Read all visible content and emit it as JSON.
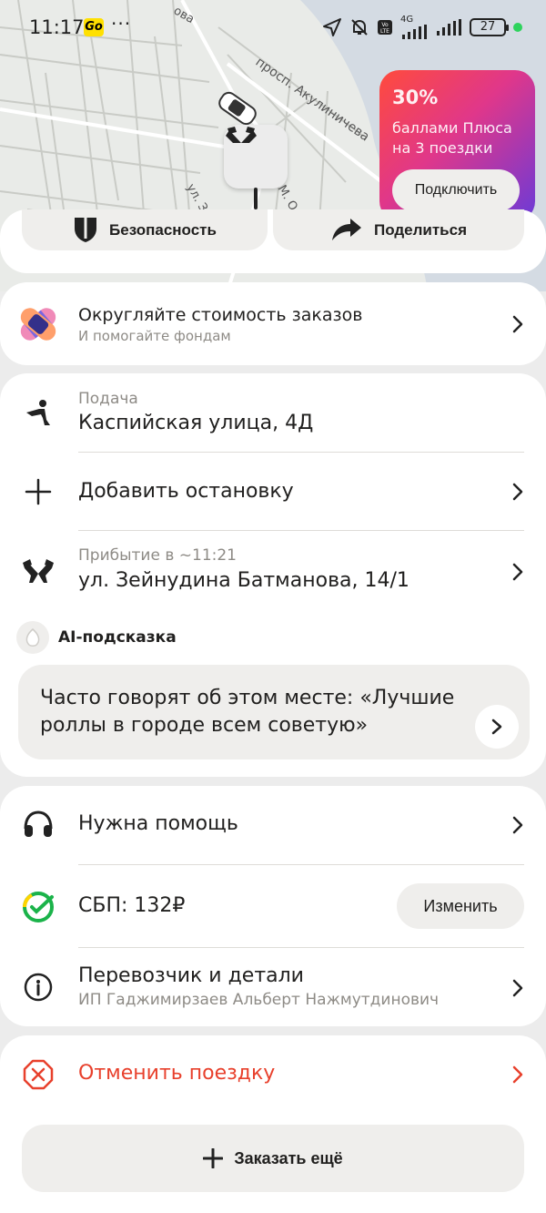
{
  "status_bar": {
    "time": "11:17",
    "app_badge": "Go",
    "more": "···",
    "network": "4G",
    "battery": "27"
  },
  "map": {
    "streets": [
      "просп. Акулиничева",
      "ул. Зей",
      "л. М. О",
      "ова"
    ]
  },
  "promo": {
    "percent": "30%",
    "description": "баллами Плюса на 3 поездки",
    "button": "Подключить"
  },
  "actions": {
    "safety": "Безопасность",
    "share": "Поделиться"
  },
  "roundup": {
    "title": "Округляйте стоимость заказов",
    "subtitle": "И помогайте фондам"
  },
  "route": {
    "pickup_label": "Подача",
    "pickup_address": "Каспийская улица, 4Д",
    "add_stop": "Добавить остановку",
    "arrival_label": "Прибытие в ~11:21",
    "destination": "ул. Зейнудина Батманова, 14/1"
  },
  "ai": {
    "title": "AI-подсказка",
    "text": "Часто говорят об этом месте: «Лучшие роллы в городе всем советую»"
  },
  "support": {
    "help": "Нужна помощь",
    "payment": "СБП: 132₽",
    "change": "Изменить",
    "carrier_title": "Перевозчик и детали",
    "carrier_name": "ИП Гаджимирзаев Альберт Нажмутдинович"
  },
  "cancel": {
    "label": "Отменить поездку"
  },
  "order_more": {
    "label": "Заказать ещё"
  },
  "colors": {
    "accent_red": "#e8402c",
    "sbp_green": "#1bb34a",
    "card_bg": "#ffffff",
    "button_bg": "#efeeec"
  }
}
